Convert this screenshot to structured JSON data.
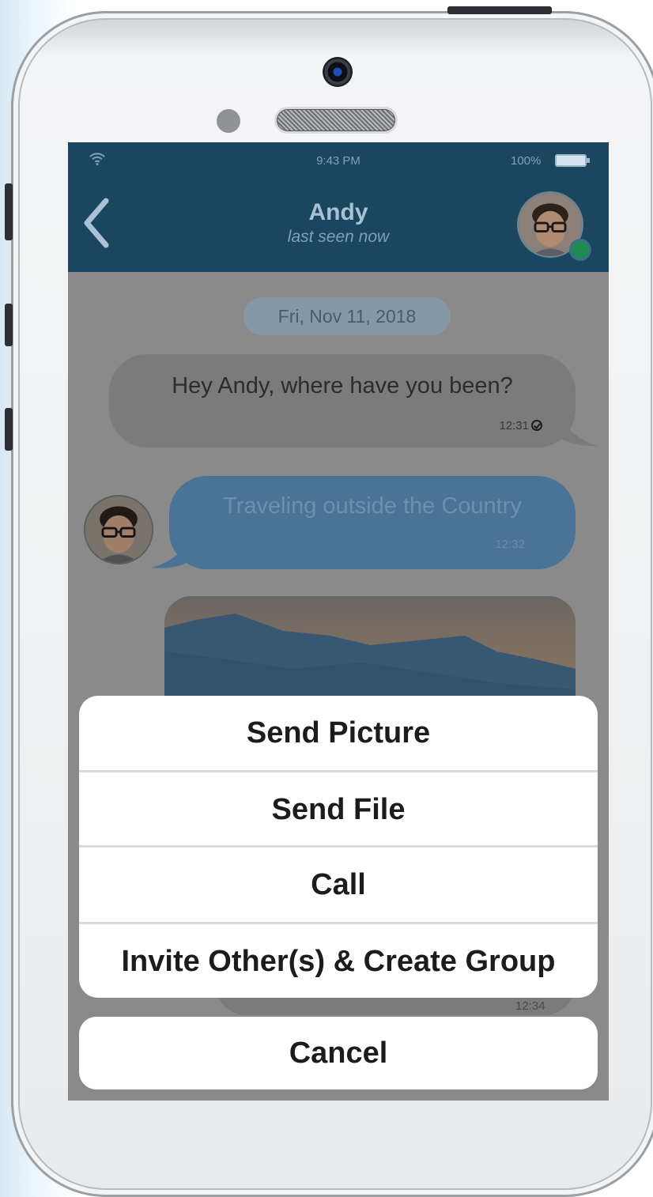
{
  "status_bar": {
    "time": "9:43 PM",
    "battery_percent": "100%",
    "battery_level": 1.0
  },
  "header": {
    "back_icon": "chevron-left-icon",
    "contact_name": "Andy",
    "contact_status": "last seen now",
    "online": true,
    "accent_color": "#1b4660"
  },
  "chat": {
    "date_label": "Fri, Nov 11, 2018",
    "messages": [
      {
        "direction": "out",
        "text": "Hey Andy, where have you been?",
        "time": "12:31",
        "read": true
      },
      {
        "direction": "in",
        "text": "Traveling outside the Country",
        "time": "12:32"
      },
      {
        "direction": "in",
        "type": "image"
      }
    ],
    "partial_time": "12:34"
  },
  "action_sheet": {
    "items": [
      {
        "label": "Send Picture"
      },
      {
        "label": "Send File"
      },
      {
        "label": "Call"
      },
      {
        "label": "Invite Other(s) & Create Group"
      }
    ],
    "cancel_label": "Cancel"
  }
}
